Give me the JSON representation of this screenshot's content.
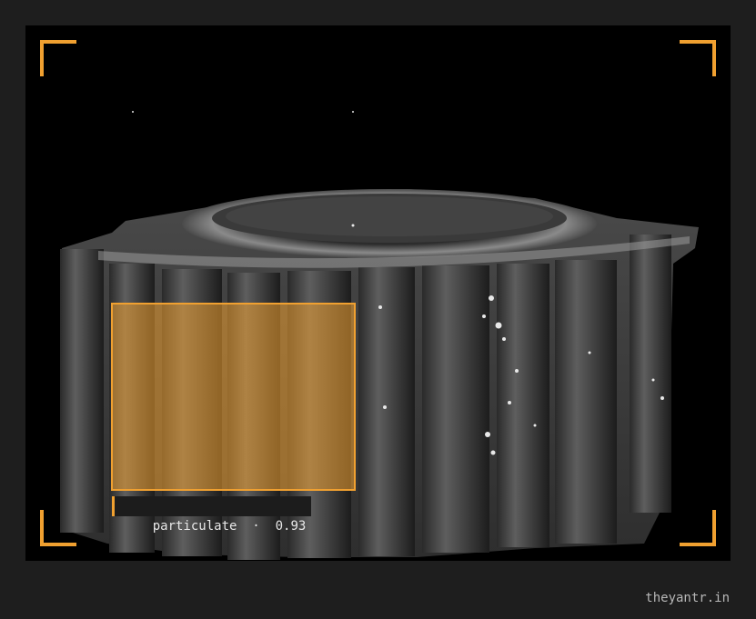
{
  "detection": {
    "label": "particulate",
    "separator": "·",
    "score": "0.93"
  },
  "footer": {
    "watermark": "theyantr.in"
  },
  "colors": {
    "accent": "#f0a030",
    "background": "#1e1e1e",
    "viewport": "#000000"
  }
}
